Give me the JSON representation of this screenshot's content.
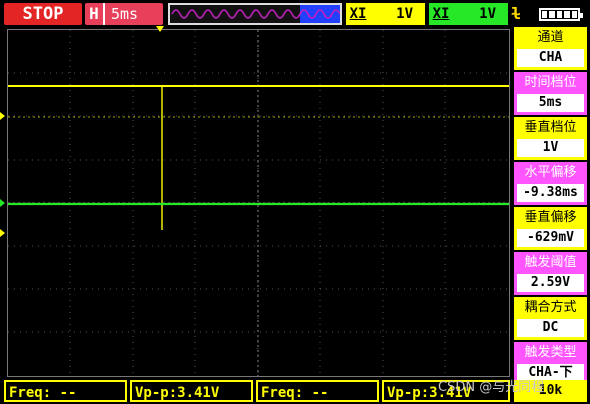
{
  "topbar": {
    "run_state": "STOP",
    "timebase_key": "H",
    "timebase_value": "5ms",
    "ch1_key": "XI",
    "ch1_value": "1V",
    "ch2_key": "XI",
    "ch2_value": "1V",
    "trigger_symbol": "ɫ"
  },
  "colors": {
    "ch1": "#ffff00",
    "ch2": "#27e827",
    "menu_pink": "#ff55ff",
    "stop": "#e32525"
  },
  "menu": [
    {
      "label": "通道",
      "value": "CHA",
      "color": "yellow"
    },
    {
      "label": "时间档位",
      "value": "5ms",
      "color": "pink"
    },
    {
      "label": "垂直档位",
      "value": "1V",
      "color": "yellow"
    },
    {
      "label": "水平偏移",
      "value": "-9.38ms",
      "color": "pink"
    },
    {
      "label": "垂直偏移",
      "value": "-629mV",
      "color": "yellow"
    },
    {
      "label": "触发阈值",
      "value": "2.59V",
      "color": "pink"
    },
    {
      "label": "耦合方式",
      "value": "DC",
      "color": "yellow"
    },
    {
      "label": "触发类型",
      "value": "CHA-下",
      "color": "pink"
    }
  ],
  "bottom": {
    "freq1": "Freq: --",
    "vpp1": "Vp-p:3.41V",
    "freq2": "Freq: --",
    "vpp2": "Vp-p:3.41V",
    "corner": "10k",
    "watermark": "CSDN @与光同程"
  }
}
